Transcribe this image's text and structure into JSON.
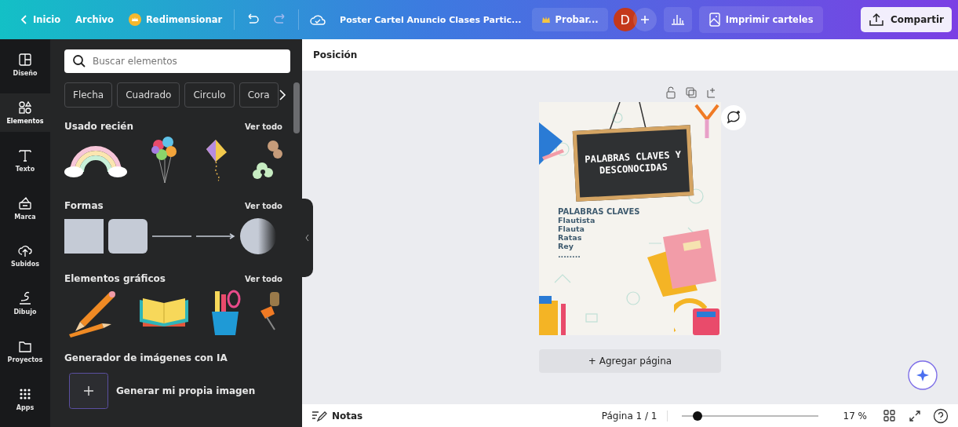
{
  "topbar": {
    "back_label": "Inicio",
    "menu_label": "Archivo",
    "resize_label": "Redimensionar",
    "title": "Poster Cartel Anuncio Clases Partic...",
    "try_label": "Probar...",
    "avatar": "D",
    "print_label": "Imprimir carteles",
    "share_label": "Compartir"
  },
  "rail": [
    {
      "label": "Diseño",
      "selected": false
    },
    {
      "label": "Elementos",
      "selected": true
    },
    {
      "label": "Texto",
      "selected": false
    },
    {
      "label": "Marca",
      "selected": false
    },
    {
      "label": "Subidos",
      "selected": false
    },
    {
      "label": "Dibujo",
      "selected": false
    },
    {
      "label": "Proyectos",
      "selected": false
    },
    {
      "label": "Apps",
      "selected": false
    }
  ],
  "panel": {
    "search": {
      "placeholder": "Buscar elementos"
    },
    "chips": [
      "Flecha",
      "Cuadrado",
      "Circulo",
      "Cora"
    ],
    "sections": [
      {
        "title": "Usado recién",
        "link": "Ver todo",
        "kind": "recent"
      },
      {
        "title": "Formas",
        "link": "Ver todo",
        "kind": "shapes"
      },
      {
        "title": "Elementos gráficos",
        "link": "Ver todo",
        "kind": "graphics"
      }
    ],
    "ai": {
      "title": "Generador de imágenes con IA",
      "button": "Generar mi propia imagen"
    }
  },
  "toolbar": {
    "label": "Posición"
  },
  "poster": {
    "heading": "PALABRAS CLAVES Y DESCONOCIDAS",
    "list_title": "PALABRAS CLAVES",
    "words": [
      "Flautista",
      "Flauta",
      "Ratas",
      "Rey",
      "........"
    ]
  },
  "add_page": "+ Agregar página",
  "footer": {
    "notes": "Notas",
    "page": "Página 1 / 1",
    "zoom": {
      "level": 0.12
    },
    "zoom_label": "17 %"
  }
}
